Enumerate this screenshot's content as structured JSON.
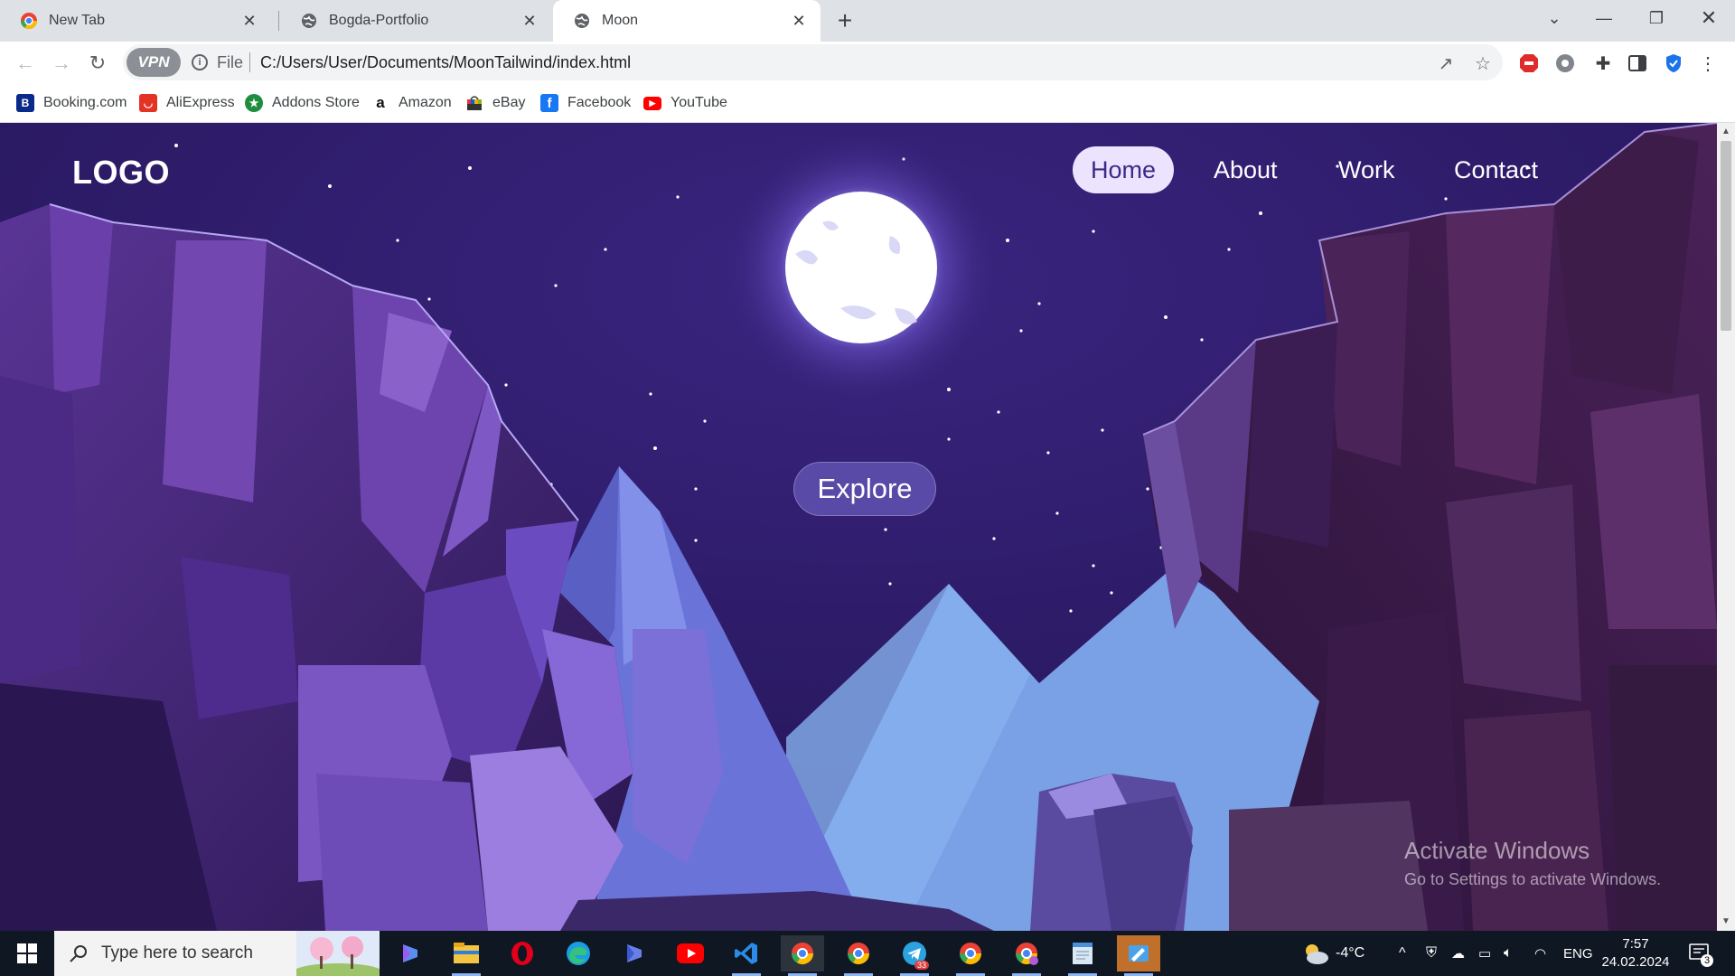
{
  "browser": {
    "tabs": [
      {
        "title": "New Tab",
        "active": false
      },
      {
        "title": "Bogda-Portfolio",
        "active": false
      },
      {
        "title": "Moon",
        "active": true
      }
    ],
    "new_tab_label": "+",
    "vpn_label": "VPN",
    "url_scheme": "File",
    "url": "C:/Users/User/Documents/MoonTailwind/index.html"
  },
  "bookmarks": [
    {
      "label": "Booking.com",
      "icon": "booking-icon",
      "color": "#0a2a8a",
      "glyph": "B"
    },
    {
      "label": "AliExpress",
      "icon": "aliexpress-icon",
      "color": "#e43225",
      "glyph": "◡"
    },
    {
      "label": "Addons Store",
      "icon": "addons-store-icon",
      "color": "#1e8e3e",
      "glyph": "★"
    },
    {
      "label": "Amazon",
      "icon": "amazon-icon",
      "color": "#ffffff",
      "glyph": "a"
    },
    {
      "label": "eBay",
      "icon": "ebay-icon",
      "color": "#2b6cb0",
      "glyph": ""
    },
    {
      "label": "Facebook",
      "icon": "facebook-icon",
      "color": "#1877f2",
      "glyph": "f"
    },
    {
      "label": "YouTube",
      "icon": "youtube-icon",
      "color": "#ff0000",
      "glyph": "▶"
    }
  ],
  "site": {
    "logo": "LOGO",
    "nav": [
      {
        "label": "Home",
        "active": true
      },
      {
        "label": "About",
        "active": false
      },
      {
        "label": "Work",
        "active": false
      },
      {
        "label": "Contact",
        "active": false
      }
    ],
    "cta": "Explore"
  },
  "watermark": {
    "title": "Activate Windows",
    "subtitle": "Go to Settings to activate Windows."
  },
  "taskbar": {
    "search_placeholder": "Type here to search",
    "apps": [
      "copilot-icon",
      "file-explorer-icon",
      "opera-icon",
      "edge-icon",
      "copilot-app-icon",
      "youtube-app-icon",
      "vscode-icon",
      "browser-icon",
      "chrome-icon",
      "telegram-icon",
      "chrome-profile-icon",
      "chrome-profile-b-icon",
      "notepad-icon",
      "paint-icon"
    ],
    "telegram_badge": "33",
    "weather": "-4°C",
    "language": "ENG",
    "time": "7:57",
    "date": "24.02.2024",
    "notifications": "3"
  },
  "colors": {
    "sky": "#2b1a63",
    "moon": "#ffffff",
    "nav_active_bg": "#ece4ff",
    "button_bg": "#5a4aa8"
  }
}
